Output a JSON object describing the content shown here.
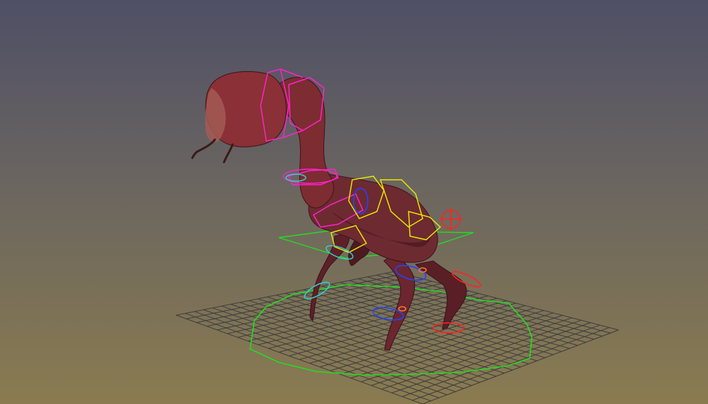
{
  "viewport": {
    "background_top": "#4f4f66",
    "background_bottom": "#8a7b50"
  },
  "scene": {
    "grid_color": "#3d3d3d",
    "skin_color": "#7a2a2e",
    "skin_dark": "#4b1d22",
    "controls": {
      "world_control_color": "#22dd22",
      "ik_color": "#ff22cc",
      "fk_color": "#e6e600",
      "left_leg_color": "#2244ff",
      "right_leg_color": "#ff2222",
      "aux_color": "#33cccc",
      "pole_color": "#ff7722"
    },
    "icons": {
      "root_locator": "crosshair-circle-icon"
    }
  }
}
